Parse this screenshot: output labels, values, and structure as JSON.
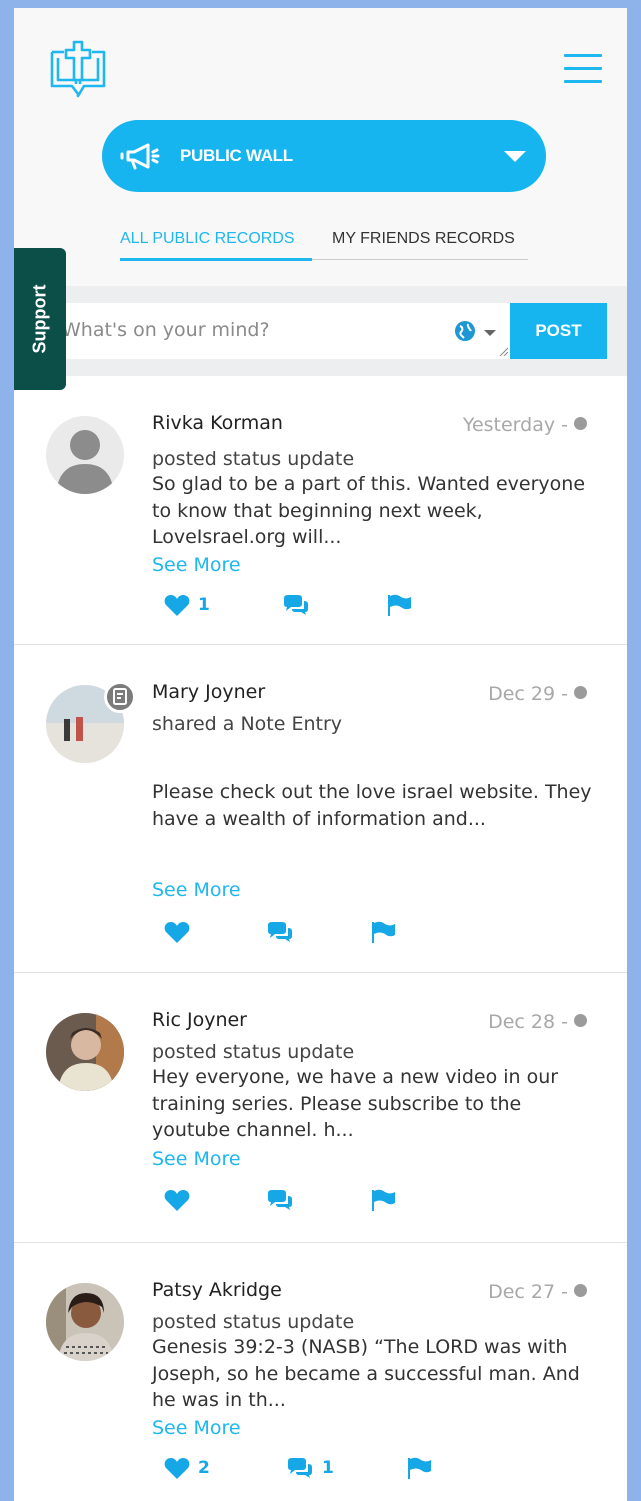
{
  "header": {
    "logo": "bible-cross-logo",
    "menu_icon": "hamburger-icon",
    "wall_selector": {
      "icon": "megaphone-icon",
      "label": "PUBLIC WALL"
    },
    "tabs": [
      {
        "label": "ALL PUBLIC RECORDS",
        "active": true
      },
      {
        "label": "MY FRIENDS RECORDS",
        "active": false
      }
    ]
  },
  "composer": {
    "placeholder": "What's on your mind?",
    "visibility_icon": "globe-icon",
    "post_label": "POST"
  },
  "support": {
    "label": "Support"
  },
  "accent_color": "#16b5ef",
  "support_color": "#0c4f49",
  "posts": [
    {
      "author": "Rivka Korman",
      "time": "Yesterday -",
      "action": "posted status update",
      "body": "So glad to be a part of this. Wanted everyone to know that beginning next week, LoveIsrael.org will...",
      "see_more": "See More",
      "likes": "1",
      "comments": ""
    },
    {
      "author": "Mary Joyner",
      "time": "Dec 29 -",
      "action": "shared a Note Entry",
      "body": "Please check out the love israel website. They have a wealth of information and...",
      "see_more": "See More",
      "likes": "",
      "comments": ""
    },
    {
      "author": "Ric Joyner",
      "time": "Dec 28 -",
      "action": "posted status update",
      "body": "Hey everyone, we have a new video in our training series. Please subscribe to the youtube channel. h...",
      "see_more": "See More",
      "likes": "",
      "comments": ""
    },
    {
      "author": "Patsy Akridge",
      "time": "Dec 27 -",
      "action": "posted status update",
      "body": "Genesis 39:2-3 (NASB) “The LORD was with Joseph, so he became a successful man. And he was in th...",
      "see_more": "See More",
      "likes": "2",
      "comments": "1"
    }
  ]
}
